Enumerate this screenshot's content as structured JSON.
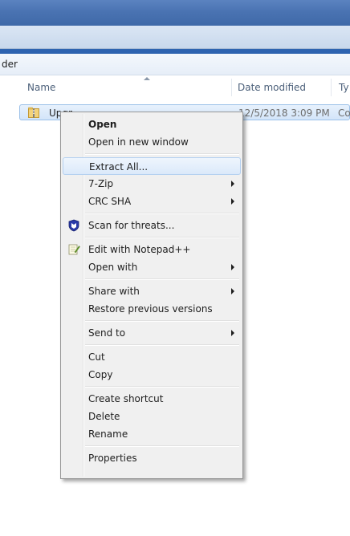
{
  "breadcrumb": {
    "text": "der"
  },
  "columns": {
    "name": "Name",
    "date_modified": "Date modified",
    "type": "Ty"
  },
  "file": {
    "name": "Upgr",
    "date": "12/5/2018 3:09 PM",
    "type": "Co"
  },
  "menu": {
    "open": "Open",
    "open_new_window": "Open in new window",
    "extract_all": "Extract All...",
    "seven_zip": "7-Zip",
    "crc_sha": "CRC SHA",
    "scan": "Scan for threats...",
    "edit_notepad": "Edit with Notepad++",
    "open_with": "Open with",
    "share_with": "Share with",
    "restore": "Restore previous versions",
    "send_to": "Send to",
    "cut": "Cut",
    "copy": "Copy",
    "create_shortcut": "Create shortcut",
    "delete": "Delete",
    "rename": "Rename",
    "properties": "Properties"
  },
  "icons": {
    "zip": "zip-folder-icon",
    "shield": "malwarebytes-shield-icon",
    "notepad": "notepad-plus-plus-icon"
  },
  "colors": {
    "titlebar": "#4a73b2",
    "highlight": "#dbe9fa",
    "menu_bg": "#f0f0f0"
  }
}
